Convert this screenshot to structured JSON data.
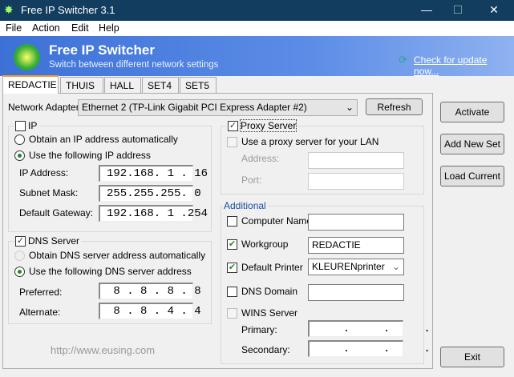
{
  "window": {
    "title": "Free IP Switcher 3.1",
    "minimize": "—",
    "maximize": "☐",
    "close": "✕"
  },
  "menu": [
    "File",
    "Action",
    "Edit",
    "Help"
  ],
  "banner": {
    "title": "Free IP Switcher",
    "subtitle": "Switch between different network settings",
    "update_link": "Check for update now..."
  },
  "tabs": [
    "REDACTIE",
    "THUIS",
    "HALL",
    "SET4",
    "SET5"
  ],
  "adapter": {
    "label": "Network Adapter:",
    "value": "Ethernet 2  (TP-Link Gigabit PCI Express Adapter #2)",
    "refresh": "Refresh"
  },
  "ip": {
    "legend": "IP",
    "checked": false,
    "auto": "Obtain an IP address automatically",
    "manual": "Use the following IP address",
    "ip_label": "IP Address:",
    "ip": "192.168. 1 . 16",
    "mask_label": "Subnet Mask:",
    "mask": "255.255.255. 0",
    "gw_label": "Default Gateway:",
    "gw": "192.168. 1 .254"
  },
  "dns": {
    "legend": "DNS Server",
    "checked": true,
    "auto": "Obtain DNS server address automatically",
    "manual": "Use the following DNS server address",
    "pref_label": "Preferred:",
    "pref": " 8 . 8 . 8 . 8",
    "alt_label": "Alternate:",
    "alt": " 8 . 8 . 4 . 4"
  },
  "proxy": {
    "legend": "Proxy Server",
    "checked": true,
    "use": "Use a proxy server for your LAN",
    "address_label": "Address:",
    "address": "",
    "port_label": "Port:",
    "port": ""
  },
  "additional": {
    "legend": "Additional",
    "computer_name": "Computer Name",
    "computer_name_value": "",
    "workgroup": "Workgroup",
    "workgroup_value": "REDACTIE",
    "printer": "Default Printer",
    "printer_value": "KLEURENprinter",
    "dns_domain": "DNS Domain",
    "dns_domain_value": "",
    "wins": "WINS Server",
    "primary_label": "Primary:",
    "primary": "    .     .     .",
    "secondary_label": "Secondary:",
    "secondary": "    .     .     ."
  },
  "buttons": {
    "activate": "Activate",
    "add": "Add New Set",
    "load": "Load Current",
    "exit": "Exit"
  },
  "footer": {
    "url": "http://www.eusing.com"
  },
  "colors": {
    "titlebar": "#123d5f",
    "banner": "#3d71d6",
    "accent": "#1a8a2a"
  }
}
